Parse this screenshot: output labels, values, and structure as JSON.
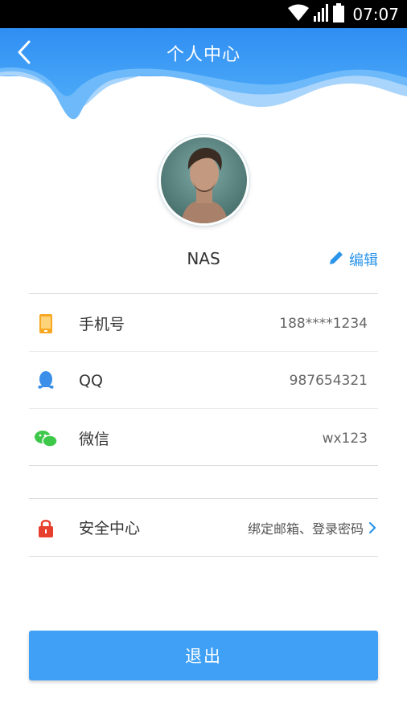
{
  "status_bar": {
    "time": "07:07"
  },
  "header": {
    "title": "个人中心"
  },
  "profile": {
    "name": "NAS",
    "edit_label": "编辑"
  },
  "contacts": [
    {
      "label": "手机号",
      "value": "188****1234",
      "icon": "phone-icon",
      "color": "#f7a823"
    },
    {
      "label": "QQ",
      "value": "987654321",
      "icon": "qq-icon",
      "color": "#3b8fe8"
    },
    {
      "label": "微信",
      "value": "wx123",
      "icon": "wechat-icon",
      "color": "#3ec84a"
    }
  ],
  "security": {
    "label": "安全中心",
    "value": "绑定邮箱、登录密码",
    "icon": "lock-icon",
    "color": "#e8402f"
  },
  "logout_label": "退出",
  "colors": {
    "accent": "#3fa0f6",
    "link": "#2c95ea"
  }
}
